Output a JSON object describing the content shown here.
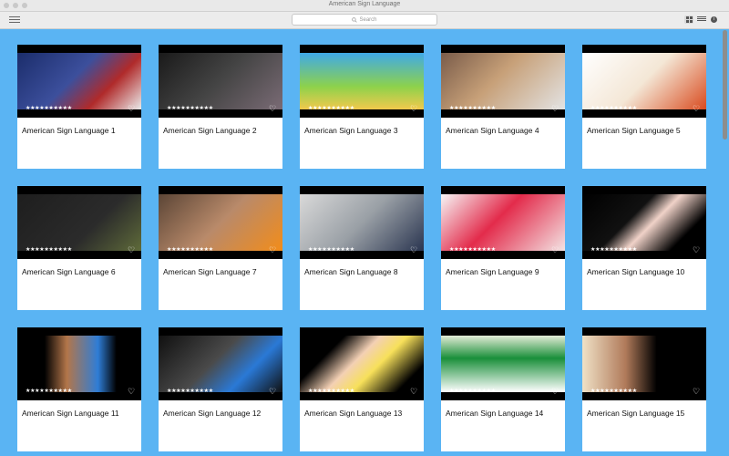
{
  "window": {
    "title": "American Sign Language"
  },
  "toolbar": {
    "search_placeholder": "Search"
  },
  "colors": {
    "background": "#5ab4f3",
    "card": "#ffffff",
    "thumbnail": "#000000"
  },
  "rating_text": "★★★★★★★★★★",
  "items": [
    {
      "title": "American Sign Language  1"
    },
    {
      "title": "American Sign Language  2"
    },
    {
      "title": "American Sign Language  3"
    },
    {
      "title": "American Sign Language  4"
    },
    {
      "title": "American Sign Language  5"
    },
    {
      "title": "American Sign Language  6"
    },
    {
      "title": "American Sign Language  7"
    },
    {
      "title": "American Sign Language  8"
    },
    {
      "title": "American Sign Language  9"
    },
    {
      "title": "American Sign Language  10"
    },
    {
      "title": "American Sign Language  11"
    },
    {
      "title": "American Sign Language  12"
    },
    {
      "title": "American Sign Language  13"
    },
    {
      "title": "American Sign Language  14"
    },
    {
      "title": "American Sign Language  15"
    }
  ]
}
